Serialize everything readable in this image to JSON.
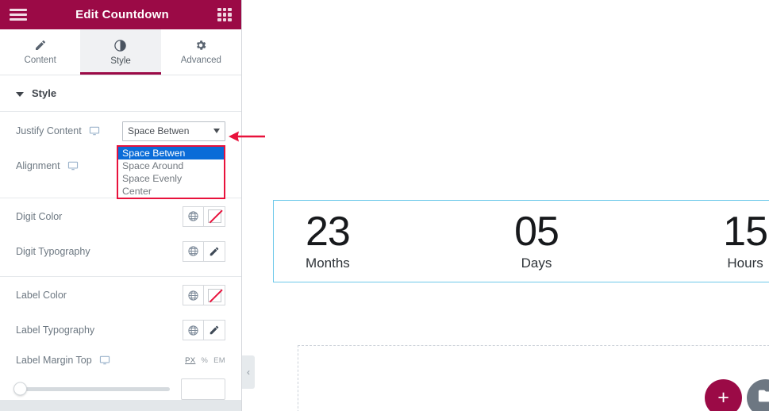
{
  "header": {
    "title": "Edit Countdown",
    "menu_icon": "hamburger-icon",
    "apps_icon": "grid-apps-icon"
  },
  "tabs": [
    {
      "label": "Content",
      "icon": "pencil-icon",
      "active": false
    },
    {
      "label": "Style",
      "icon": "contrast-icon",
      "active": true
    },
    {
      "label": "Advanced",
      "icon": "gear-icon",
      "active": false
    }
  ],
  "section": {
    "title": "Style",
    "expanded": true
  },
  "controls": {
    "justify_content": {
      "label": "Justify Content",
      "responsive_icon": "desktop-monitor-icon",
      "value": "Space Betwen",
      "open": true,
      "options": [
        "Space Betwen",
        "Space Around",
        "Space Evenly",
        "Center"
      ],
      "selected_index": 0
    },
    "alignment": {
      "label": "Alignment",
      "responsive_icon": "desktop-monitor-icon"
    },
    "digit_color": {
      "label": "Digit Color",
      "global_icon": "globe-icon",
      "swatch_icon": "no-color-swatch-icon",
      "value": ""
    },
    "digit_typography": {
      "label": "Digit Typography",
      "global_icon": "globe-icon",
      "edit_icon": "pencil-icon"
    },
    "label_color": {
      "label": "Label Color",
      "global_icon": "globe-icon",
      "swatch_icon": "no-color-swatch-icon",
      "value": ""
    },
    "label_typography": {
      "label": "Label Typography",
      "global_icon": "globe-icon",
      "edit_icon": "pencil-icon"
    },
    "label_margin_top": {
      "label": "Label Margin Top",
      "responsive_icon": "desktop-monitor-icon",
      "units": [
        "PX",
        "%",
        "EM"
      ],
      "active_unit": "PX",
      "slider_value": 0,
      "input_value": "",
      "input_placeholder": ""
    }
  },
  "canvas": {
    "collapse_icon": "chevron-left-icon",
    "countdown": {
      "items": [
        {
          "digit": "23",
          "label": "Months"
        },
        {
          "digit": "05",
          "label": "Days"
        },
        {
          "digit": "15",
          "label": "Hours"
        }
      ]
    },
    "add_button_label": "+",
    "add_button_icon": "plus-icon",
    "folder_button_icon": "folder-icon"
  },
  "annotation": {
    "arrow_icon": "arrow-left-annotation",
    "color": "#e8123c"
  },
  "colors": {
    "brand": "#9b0a46",
    "accent_red": "#e8123c",
    "select_blue": "#0a6cd8",
    "widget_border": "#6ec9ea"
  }
}
